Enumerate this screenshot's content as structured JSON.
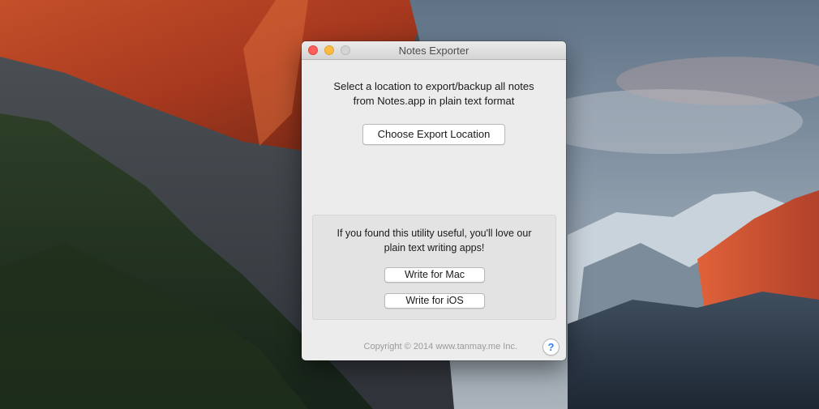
{
  "window": {
    "title": "Notes Exporter"
  },
  "main": {
    "intro_line1": "Select a location to export/backup all notes",
    "intro_line2": "from Notes.app in plain text format",
    "export_button_label": "Choose Export Location"
  },
  "promo": {
    "text_line1": "If you found this utility useful, you'll love our",
    "text_line2": "plain text writing apps!",
    "mac_button_label": "Write for Mac",
    "ios_button_label": "Write for iOS"
  },
  "footer": {
    "copyright": "Copyright © 2014 www.tanmay.me Inc.",
    "help_glyph": "?"
  },
  "icons": {
    "close": "close-icon",
    "minimize": "minimize-icon",
    "zoom": "zoom-icon",
    "help": "help-icon"
  },
  "colors": {
    "close": "#fc605c",
    "minimize": "#fdbc40",
    "zoom_disabled": "#d4d4d4",
    "help_accent": "#2f7ff5"
  }
}
